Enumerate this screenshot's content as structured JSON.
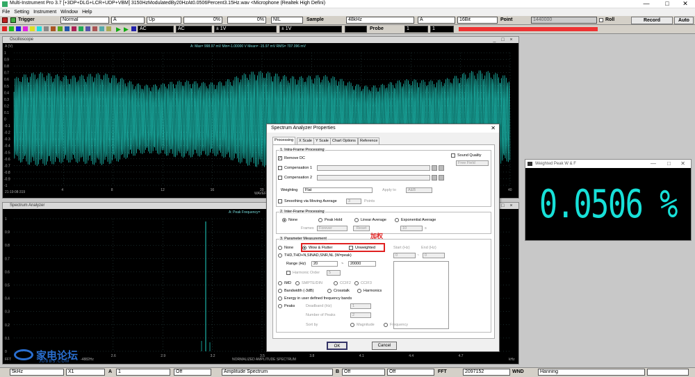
{
  "window": {
    "title": "Multi-Instrument Pro 3.7   [+3DP+DLG+LCR+UDP+VBM]    3150HzModulatedBy20HzAt0.0506Percent3.15Hz.wav   <Microphone (Realtek High Defini)",
    "minimize": "—",
    "maximize": "□",
    "close": "✕"
  },
  "menu": [
    "File",
    "Setting",
    "Instrument",
    "Window",
    "Help"
  ],
  "toolbar1": {
    "trigger_label": "Trigger",
    "trigger_mode": "Normal",
    "trigger_channel": "A",
    "trigger_edge": "Up",
    "pct1": "0%",
    "pct2": "0%",
    "nil": "NIL",
    "sample_label": "Sample",
    "sample_rate": "48kHz",
    "channel": "A",
    "bits": "16Bit",
    "point_label": "Point",
    "point_value": "1440000",
    "roll_label": "Roll",
    "record_label": "Record",
    "auto_label": "Auto"
  },
  "toolbar2": {
    "coupling_a": "AC",
    "coupling_b": "AC",
    "range_a": "± 1V",
    "range_b": "± 1V",
    "probe_label": "Probe",
    "probe_a": "1",
    "probe_b": "1"
  },
  "oscilloscope": {
    "title": "Oscilloscope",
    "readout": "A: Max=  998.97 mV  Min=-1.00000  V  Mean=    -15.97 mV  RMS=  707.096 mV",
    "channel_tag": "A (V)",
    "y_ticks": [
      "1",
      "0.9",
      "0.8",
      "0.7",
      "0.6",
      "0.5",
      "0.4",
      "0.3",
      "0.2",
      "0.1",
      "0",
      "-0.1",
      "-0.2",
      "-0.3",
      "-0.4",
      "-0.5",
      "-0.6",
      "-0.7",
      "-0.8",
      "-0.9",
      "-1"
    ],
    "x_ticks": [
      "4",
      "8",
      "12",
      "16",
      "20",
      "24",
      "28",
      "32",
      "36",
      "40"
    ],
    "timestamp": "21:19:08:319",
    "x_label": "WAVEFO"
  },
  "spectrum": {
    "title": "Spectrum Analyzer",
    "readout": "A: Peak Frequency=",
    "y_ticks": [
      "1",
      "0.9",
      "0.8",
      "0.7",
      "0.6",
      "0.5",
      "0.4",
      "0.3",
      "0.2",
      "0.1",
      "0"
    ],
    "x_ticks": [
      "2.6",
      "2.9",
      "3.2",
      "3.5",
      "3.8",
      "4.1",
      "4.4",
      "4.7"
    ],
    "x_unit": "kHz",
    "fft_info": "FFT",
    "freq_res": "-4882Hz",
    "x_label": "NORMALIZED AMPLITUDE SPECTRUM"
  },
  "dialog": {
    "title": "Spectrum Analyzer Properties",
    "close": "✕",
    "tabs": [
      "Processing",
      "X Scale",
      "Y Scale",
      "Chart Options",
      "Reference"
    ],
    "g1": {
      "title": "1. Intra-Frame Processing",
      "remove_dc": "Remove DC",
      "sound_quality": "Sound Quality",
      "free_field": "Free Field",
      "comp1": "Compensation 1",
      "comp2": "Compensation 2",
      "weighting": "Weighting",
      "weighting_val": "Flat",
      "apply_to": "Apply to",
      "apply_val": "A&B",
      "smoothing": "Smoothing via Moving Average",
      "smooth_n": "3",
      "points": "Points"
    },
    "g2": {
      "title": "2. Inter-Frame Processing",
      "none": "None",
      "peak_hold": "Peak Hold",
      "linear_avg": "Linear Average",
      "exp_avg": "Exponential Average",
      "frames": "Frames",
      "forever": "Forever",
      "reset": "Reset",
      "n10": "10",
      "s": "s"
    },
    "g3": {
      "title": "3. Parameter Measurement",
      "none": "None",
      "wow": "Wow & Flutter",
      "unweighted": "Unweighted",
      "start_hz": "Start (Hz)",
      "end_hz": "End (Hz)",
      "start_val": "0",
      "end_val": "0",
      "thd": "THD,THD+N,SINAD,SNR,NL (W=peak)",
      "range": "Range (Hz)",
      "range_lo": "20",
      "tilde": "~",
      "range_hi": "20000",
      "harmonic_order": "Harmonic Order",
      "harm_val": "5",
      "imd": "IMD",
      "smpte": "SMPTE/DIN",
      "ccif2": "CCIF2",
      "ccif3": "CCIF3",
      "bandwidth": "Bandwidth (-3dB)",
      "crosstalk": "Crosstalk",
      "harmonics": "Harmonics",
      "energy": "Energy in user defined frequency bands",
      "peaks": "Peaks",
      "deadband": "Deadband (Hz)",
      "dead_val": "1",
      "num_peaks": "Number of Peaks",
      "num_val": "2",
      "sort_by": "Sort by",
      "magnitude": "Magnitude",
      "frequency": "Frequency"
    },
    "annotation": "加权",
    "ok": "OK",
    "cancel": "Cancel"
  },
  "wpk": {
    "title": "Weighted Peak W & F",
    "value": "0.0506 %"
  },
  "bottombar": {
    "rbw": "5kHz",
    "zoom": "X1",
    "ch_a": "A",
    "ch_a_val": "1",
    "off1": "Off",
    "mode": "Amplitude Spectrum",
    "ch_b": "B",
    "off2": "Off",
    "off3": "Off",
    "fft_label": "FFT",
    "fft_val": "2097152",
    "wnd_label": "WND",
    "wnd_val": "Hanning"
  },
  "watermark": "家电论坛",
  "watermark_sub": "JDBBS.COM",
  "colors": {
    "trace": "#1fd6c8",
    "grid": "#335555",
    "annotation_red": "#e02020",
    "wpk_digits": "#17e0d8"
  }
}
